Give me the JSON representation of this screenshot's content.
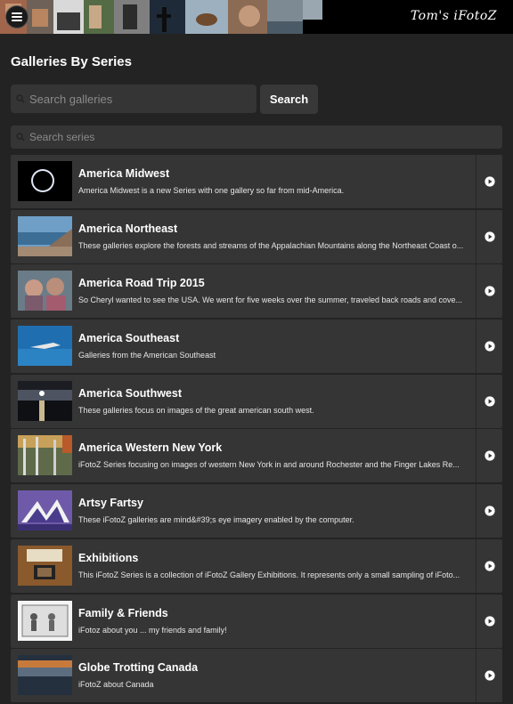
{
  "header": {
    "brand": "Tom's iFotoZ",
    "menu_icon": "hamburger-icon"
  },
  "page": {
    "title": "Galleries By Series"
  },
  "search": {
    "placeholder": "Search galleries",
    "button_label": "Search",
    "icon": "search-icon"
  },
  "series_search": {
    "placeholder": "Search series",
    "icon": "search-icon"
  },
  "series": [
    {
      "title": "America Midwest",
      "desc": "America Midwest is a new Series with one gallery so far from mid-America."
    },
    {
      "title": "America Northeast",
      "desc": "These galleries explore the forests and streams of the Appalachian Mountains along the Northeast Coast o..."
    },
    {
      "title": "America Road Trip 2015",
      "desc": "So Cheryl wanted to see the USA. We went for five weeks over the summer, traveled back roads and cove..."
    },
    {
      "title": "America Southeast",
      "desc": "Galleries from the American Southeast"
    },
    {
      "title": "America Southwest",
      "desc": "These galleries focus on images of the great american south west."
    },
    {
      "title": "America Western New York",
      "desc": "iFotoZ Series focusing on images of western New York in and around Rochester and the Finger Lakes Re..."
    },
    {
      "title": "Artsy Fartsy",
      "desc": "These iFotoZ galleries are mind&#39;s eye imagery enabled by the computer."
    },
    {
      "title": "Exhibitions",
      "desc": "This iFotoZ Series is a collection of iFotoZ Gallery Exhibitions. It represents only a small sampling of iFoto..."
    },
    {
      "title": "Family & Friends",
      "desc": "iFotoz about you ... my friends and family!"
    },
    {
      "title": "Globe Trotting Canada",
      "desc": "iFotoZ about Canada"
    }
  ],
  "row_action_icon": "play-circle-icon",
  "colors": {
    "background": "#232323",
    "row": "#353535",
    "header": "#000000"
  }
}
